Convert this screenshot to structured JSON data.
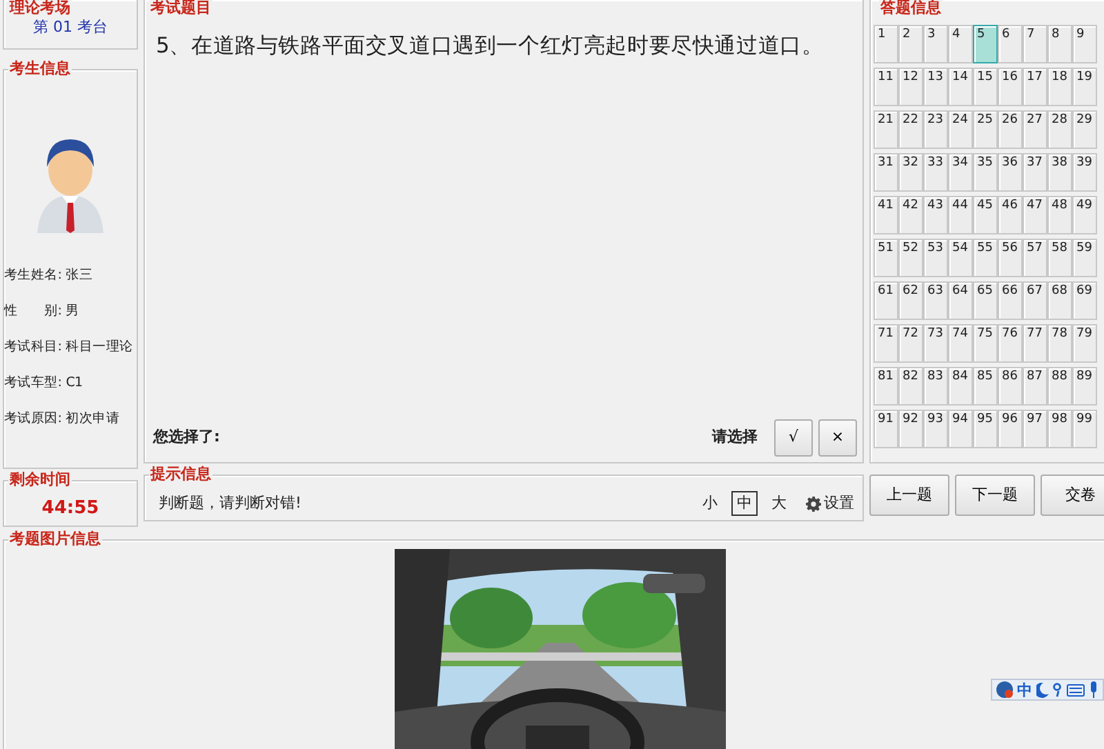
{
  "exam_room": {
    "title": "理论考场",
    "seat": "第 01 考台"
  },
  "candidate": {
    "title": "考生信息",
    "fields": [
      {
        "label": "考生姓名:",
        "value": "张三"
      },
      {
        "label": "性　　别:",
        "value": "男"
      },
      {
        "label": "考试科目:",
        "value": "科目一理论"
      },
      {
        "label": "考试车型:",
        "value": "C1"
      },
      {
        "label": "考试原因:",
        "value": "初次申请"
      }
    ]
  },
  "timer": {
    "title": "剩余时间",
    "value": "44:55"
  },
  "question": {
    "title": "考试题目",
    "text": "5、在道路与铁路平面交叉道口遇到一个红灯亮起时要尽快通过道口。",
    "answer_label": "您选择了:",
    "prompt": "请选择",
    "choices": [
      "√",
      "×"
    ]
  },
  "hint": {
    "title": "提示信息",
    "text": "判断题，请判断对错!",
    "font_sizes": [
      {
        "label": "小",
        "selected": false
      },
      {
        "label": "中",
        "selected": true
      },
      {
        "label": "大",
        "selected": false
      }
    ],
    "settings": "设置"
  },
  "answer_sheet": {
    "title": "答题信息",
    "cells": [
      {
        "label": "1",
        "selected": false
      },
      {
        "label": "2",
        "selected": false
      },
      {
        "label": "3",
        "selected": false
      },
      {
        "label": "4",
        "selected": false
      },
      {
        "label": "5",
        "selected": true
      },
      {
        "label": "6",
        "selected": false
      },
      {
        "label": "7",
        "selected": false
      },
      {
        "label": "8",
        "selected": false
      },
      {
        "label": "9",
        "selected": false
      },
      {
        "label": "11",
        "selected": false
      },
      {
        "label": "12",
        "selected": false
      },
      {
        "label": "13",
        "selected": false
      },
      {
        "label": "14",
        "selected": false
      },
      {
        "label": "15",
        "selected": false
      },
      {
        "label": "16",
        "selected": false
      },
      {
        "label": "17",
        "selected": false
      },
      {
        "label": "18",
        "selected": false
      },
      {
        "label": "19",
        "selected": false
      },
      {
        "label": "21",
        "selected": false
      },
      {
        "label": "22",
        "selected": false
      },
      {
        "label": "23",
        "selected": false
      },
      {
        "label": "24",
        "selected": false
      },
      {
        "label": "25",
        "selected": false
      },
      {
        "label": "26",
        "selected": false
      },
      {
        "label": "27",
        "selected": false
      },
      {
        "label": "28",
        "selected": false
      },
      {
        "label": "29",
        "selected": false
      },
      {
        "label": "31",
        "selected": false
      },
      {
        "label": "32",
        "selected": false
      },
      {
        "label": "33",
        "selected": false
      },
      {
        "label": "34",
        "selected": false
      },
      {
        "label": "35",
        "selected": false
      },
      {
        "label": "36",
        "selected": false
      },
      {
        "label": "37",
        "selected": false
      },
      {
        "label": "38",
        "selected": false
      },
      {
        "label": "39",
        "selected": false
      },
      {
        "label": "41",
        "selected": false
      },
      {
        "label": "42",
        "selected": false
      },
      {
        "label": "43",
        "selected": false
      },
      {
        "label": "44",
        "selected": false
      },
      {
        "label": "45",
        "selected": false
      },
      {
        "label": "46",
        "selected": false
      },
      {
        "label": "47",
        "selected": false
      },
      {
        "label": "48",
        "selected": false
      },
      {
        "label": "49",
        "selected": false
      },
      {
        "label": "51",
        "selected": false
      },
      {
        "label": "52",
        "selected": false
      },
      {
        "label": "53",
        "selected": false
      },
      {
        "label": "54",
        "selected": false
      },
      {
        "label": "55",
        "selected": false
      },
      {
        "label": "56",
        "selected": false
      },
      {
        "label": "57",
        "selected": false
      },
      {
        "label": "58",
        "selected": false
      },
      {
        "label": "59",
        "selected": false
      },
      {
        "label": "61",
        "selected": false
      },
      {
        "label": "62",
        "selected": false
      },
      {
        "label": "63",
        "selected": false
      },
      {
        "label": "64",
        "selected": false
      },
      {
        "label": "65",
        "selected": false
      },
      {
        "label": "66",
        "selected": false
      },
      {
        "label": "67",
        "selected": false
      },
      {
        "label": "68",
        "selected": false
      },
      {
        "label": "69",
        "selected": false
      },
      {
        "label": "71",
        "selected": false
      },
      {
        "label": "72",
        "selected": false
      },
      {
        "label": "73",
        "selected": false
      },
      {
        "label": "74",
        "selected": false
      },
      {
        "label": "75",
        "selected": false
      },
      {
        "label": "76",
        "selected": false
      },
      {
        "label": "77",
        "selected": false
      },
      {
        "label": "78",
        "selected": false
      },
      {
        "label": "79",
        "selected": false
      },
      {
        "label": "81",
        "selected": false
      },
      {
        "label": "82",
        "selected": false
      },
      {
        "label": "83",
        "selected": false
      },
      {
        "label": "84",
        "selected": false
      },
      {
        "label": "85",
        "selected": false
      },
      {
        "label": "86",
        "selected": false
      },
      {
        "label": "87",
        "selected": false
      },
      {
        "label": "88",
        "selected": false
      },
      {
        "label": "89",
        "selected": false
      },
      {
        "label": "91",
        "selected": false
      },
      {
        "label": "92",
        "selected": false
      },
      {
        "label": "93",
        "selected": false
      },
      {
        "label": "94",
        "selected": false
      },
      {
        "label": "95",
        "selected": false
      },
      {
        "label": "96",
        "selected": false
      },
      {
        "label": "97",
        "selected": false
      },
      {
        "label": "98",
        "selected": false
      },
      {
        "label": "99",
        "selected": false
      }
    ]
  },
  "nav_buttons": [
    "上一题",
    "下一题",
    "交卷"
  ],
  "image_panel": {
    "title": "考题图片信息"
  },
  "ime_bar": {
    "mode": "中"
  }
}
